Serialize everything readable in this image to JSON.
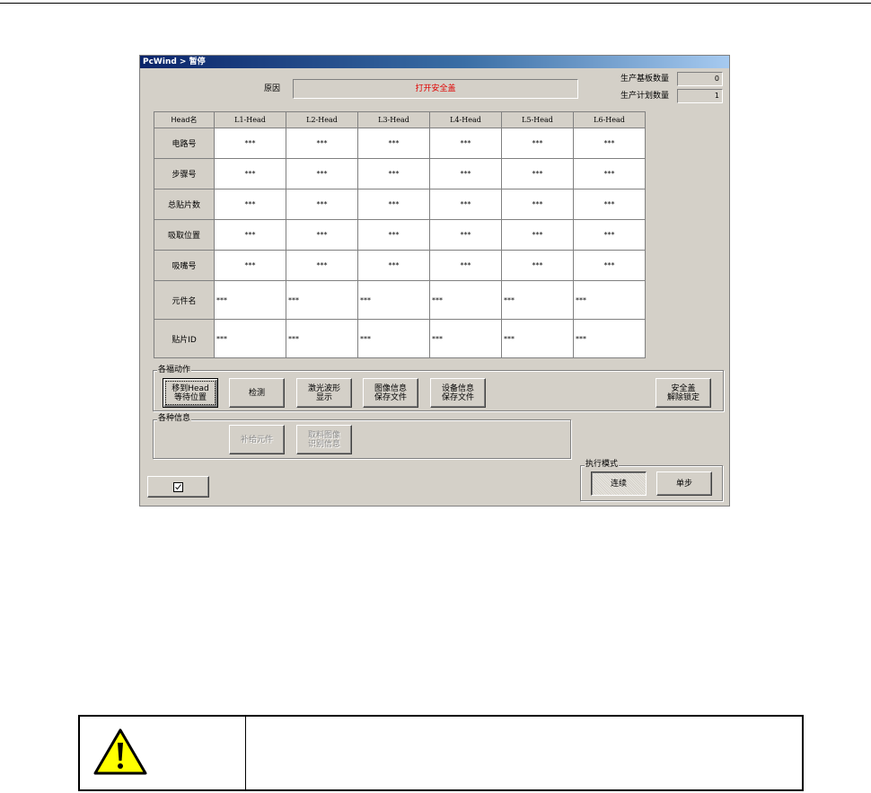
{
  "window": {
    "title": "PcWind > 暂停"
  },
  "reason": {
    "label": "原因",
    "value": "打开安全盖"
  },
  "counters": {
    "produced_label": "生产基板数量",
    "produced_value": "0",
    "planned_label": "生产计划数量",
    "planned_value": "1"
  },
  "table": {
    "corner_header": "Head名",
    "columns": [
      "L1-Head",
      "L2-Head",
      "L3-Head",
      "L4-Head",
      "L5-Head",
      "L6-Head"
    ],
    "rows": [
      {
        "label": "电路号",
        "cells": [
          "***",
          "***",
          "***",
          "***",
          "***",
          "***"
        ]
      },
      {
        "label": "步骤号",
        "cells": [
          "***",
          "***",
          "***",
          "***",
          "***",
          "***"
        ]
      },
      {
        "label": "总贴片数",
        "cells": [
          "***",
          "***",
          "***",
          "***",
          "***",
          "***"
        ]
      },
      {
        "label": "吸取位置",
        "cells": [
          "***",
          "***",
          "***",
          "***",
          "***",
          "***"
        ]
      },
      {
        "label": "吸嘴号",
        "cells": [
          "***",
          "***",
          "***",
          "***",
          "***",
          "***"
        ]
      },
      {
        "label": "元件名",
        "cells": [
          "***",
          "***",
          "***",
          "***",
          "***",
          "***"
        ]
      },
      {
        "label": "贴片ID",
        "cells": [
          "***",
          "***",
          "***",
          "***",
          "***",
          "***"
        ]
      }
    ]
  },
  "actions": {
    "group_label": "各福动作",
    "move_head": "移到Head\n等待位置",
    "check": "检测",
    "laser_waveform": "激光波形\n显示",
    "save_image": "图像信息\n保存文件",
    "save_device": "设备信息\n保存文件",
    "unlock_cover": "安全盖\n解除锁定"
  },
  "info": {
    "group_label": "各种信息",
    "supply_part": "补给元件",
    "fetch_image": "取料图像\n识别信息"
  },
  "run_mode": {
    "group_label": "执行模式",
    "continuous": "连续",
    "single_step": "单步"
  },
  "bottom_left_icon": "checkbox-icon",
  "caution": {
    "icon": "warning-triangle-icon",
    "text": ""
  }
}
